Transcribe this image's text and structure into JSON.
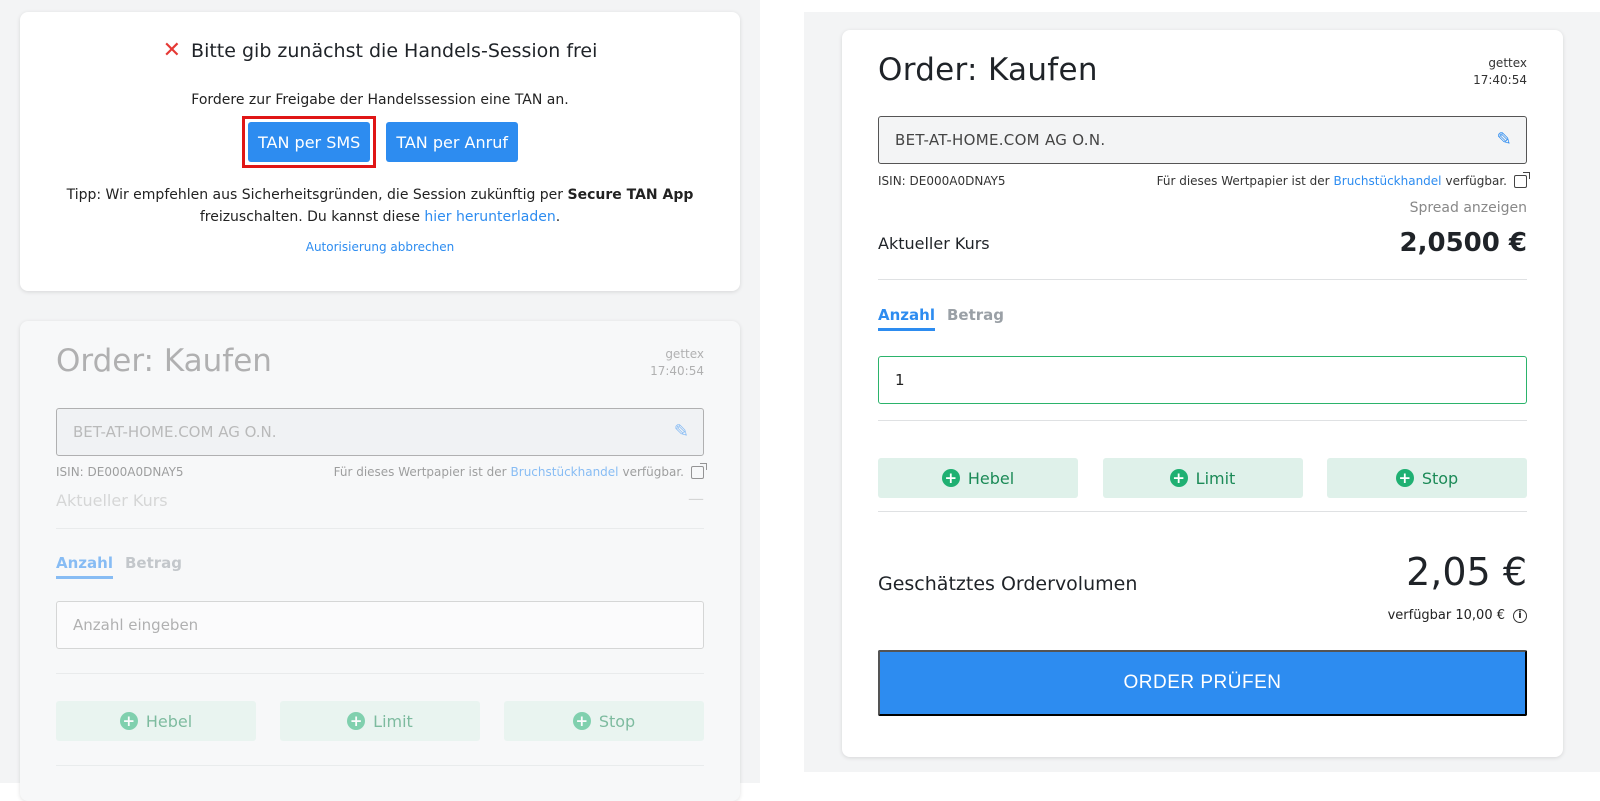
{
  "tan_dialog": {
    "title": "Bitte gib zunächst die Handels-Session frei",
    "subtitle": "Fordere zur Freigabe der Handelssession eine TAN an.",
    "sms_button": "TAN per SMS",
    "call_button": "TAN per Anruf",
    "tip_prefix": "Tipp: Wir empfehlen aus Sicherheitsgründen, die Session zukünftig per",
    "tip_bold": "Secure TAN App",
    "tip_line2_prefix": "freizuschalten. Du kannst diese",
    "tip_link": "hier herunterladen",
    "tip_end": ".",
    "cancel_link": "Autorisierung abbrechen"
  },
  "ghost_order": {
    "title": "Order: Kaufen",
    "exchange": "gettex",
    "time": "17:40:54",
    "stock_name": "BET-AT-HOME.COM AG O.N.",
    "isin": "ISIN: DE000A0DNAY5",
    "frac_prefix": "Für dieses Wertpapier ist der",
    "frac_link": "Bruchstückhandel",
    "frac_suffix": "verfügbar.",
    "kurs_label": "Aktueller Kurs",
    "kurs_value": "—",
    "tab_qty": "Anzahl",
    "tab_amount": "Betrag",
    "qty_placeholder": "Anzahl eingeben",
    "opt_hebel": "Hebel",
    "opt_limit": "Limit",
    "opt_stop": "Stop"
  },
  "order": {
    "title": "Order: Kaufen",
    "exchange": "gettex",
    "time": "17:40:54",
    "stock_name": "BET-AT-HOME.COM AG O.N.",
    "isin": "ISIN: DE000A0DNAY5",
    "frac_prefix": "Für dieses Wertpapier ist der",
    "frac_link": "Bruchstückhandel",
    "frac_suffix": "verfügbar.",
    "spread_link": "Spread anzeigen",
    "kurs_label": "Aktueller Kurs",
    "kurs_value": "2,0500 €",
    "tab_qty": "Anzahl",
    "tab_amount": "Betrag",
    "qty_value": "1",
    "opt_hebel": "Hebel",
    "opt_limit": "Limit",
    "opt_stop": "Stop",
    "volume_label": "Geschätztes Ordervolumen",
    "volume_value": "2,05 €",
    "available": "verfügbar 10,00 €",
    "submit": "ORDER PRÜFEN"
  },
  "colors": {
    "accent": "#2d8cf0",
    "highlight_border": "#e01616",
    "success": "#1fb072"
  }
}
